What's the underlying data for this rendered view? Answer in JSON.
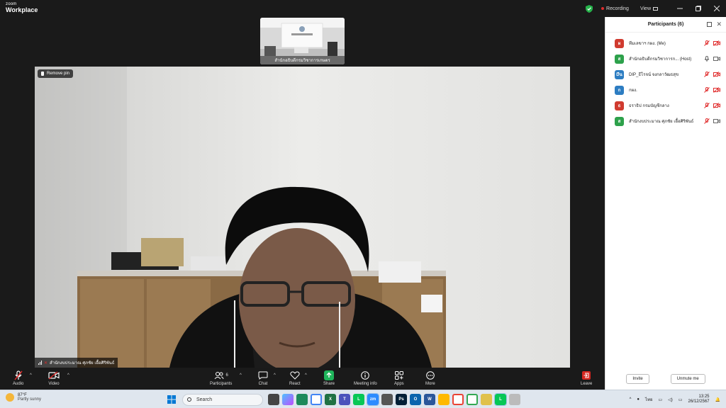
{
  "app": {
    "brand_line1": "zoom",
    "brand_line2": "Workplace",
    "recording_label": "Recording",
    "view_label": "View",
    "window_controls": [
      "minimize",
      "maximize",
      "close"
    ]
  },
  "stage": {
    "thumbnail_label": "สำนักอธิบดีกรมวิชาการเกษตร",
    "remove_pin_label": "Remove pin",
    "speaker_label": "สำนักงบประมาณ ศุภชัย เอื้อศิริพันธ์"
  },
  "panel": {
    "title": "Participants (6)",
    "participants": [
      {
        "initial": "ผ",
        "name": "ทีมเลขาฯ กผง. (Me)",
        "color": "#d03b2f",
        "audio": "muted",
        "video": "off"
      },
      {
        "initial": "ส",
        "name": "สำนักอธิบดีกรมวิชาการก... (Host)",
        "color": "#2da14b",
        "audio": "on",
        "video": "on"
      },
      {
        "initial": "Dีน",
        "name": "DIP_ธีโรจน์ จงกลาวัฒธสุข",
        "color": "#2d7dc2",
        "audio": "muted",
        "video": "off"
      },
      {
        "initial": "ก",
        "name": "กผง.",
        "color": "#2d7dc2",
        "audio": "muted",
        "video": "off"
      },
      {
        "initial": "ธ",
        "name": "ธราธิป กรมบัญชีกลาง",
        "color": "#d03b2f",
        "audio": "muted",
        "video": "off"
      },
      {
        "initial": "ส",
        "name": "สำนักงบประมาณ ศุภชัย เอื้อศิริพันธ์",
        "color": "#2da14b",
        "audio": "muted",
        "video": "on"
      }
    ],
    "invite_label": "Invite",
    "unmute_me_label": "Unmute me"
  },
  "toolbar": {
    "audio_label": "Audio",
    "video_label": "Video",
    "participants_label": "Participants",
    "participants_count": "6",
    "chat_label": "Chat",
    "react_label": "React",
    "share_label": "Share",
    "meeting_info_label": "Meeting info",
    "apps_label": "Apps",
    "more_label": "More",
    "leave_label": "Leave"
  },
  "taskbar": {
    "weather_temp": "87°F",
    "weather_desc": "Partly sunny",
    "search_placeholder": "Search",
    "lang": "ไทย",
    "time": "13:25",
    "date": "26/12/2567",
    "colors": {
      "zoom": "#2d8cff",
      "line": "#06c755",
      "excel": "#1f7244",
      "word": "#2b579a",
      "ps": "#001e36",
      "outlook": "#0a64ad"
    }
  }
}
